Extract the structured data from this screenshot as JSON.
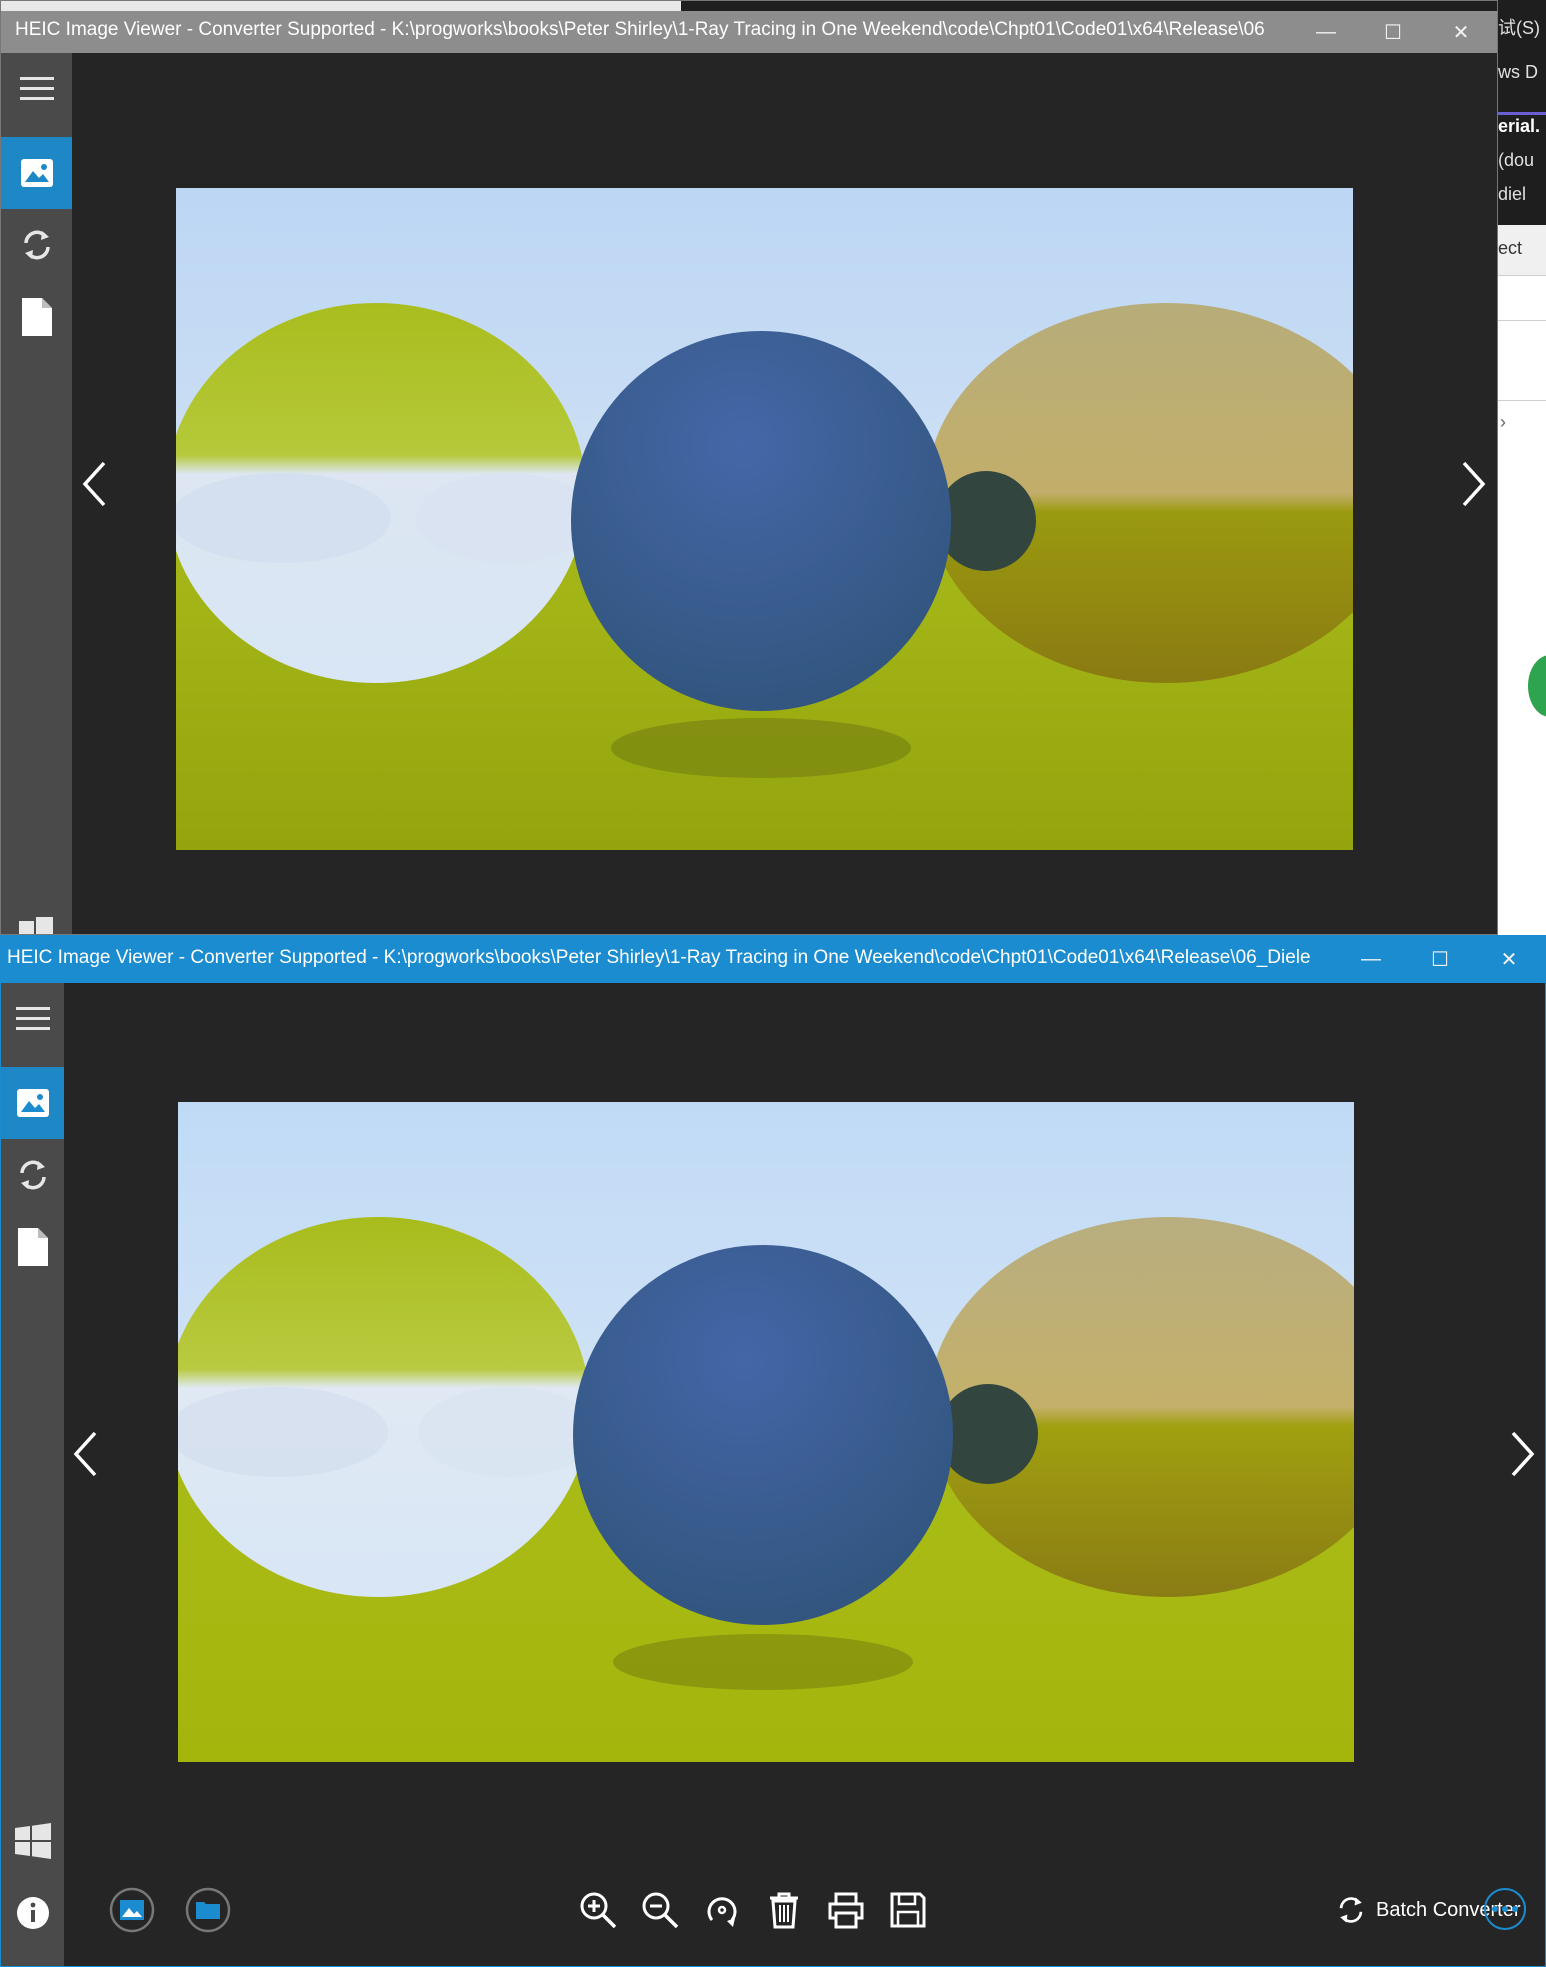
{
  "background_window": {
    "lines": [
      "试(S)",
      "ws D",
      "erial.",
      "(dou",
      "diel",
      "ect"
    ],
    "accent_color": "#6b5fd6"
  },
  "window1": {
    "title": "HEIC Image Viewer - Converter Supported - K:\\progworks\\books\\Peter Shirley\\1-Ray Tracing in One Weekend\\code\\Chpt01\\Code01\\x64\\Release\\06",
    "controls": {
      "minimize": "—",
      "maximize": "☐",
      "close": "✕"
    },
    "sidebar": [
      "menu-icon",
      "image-icon",
      "sync-icon",
      "file-icon"
    ],
    "nav": {
      "prev": "‹",
      "next": "›"
    },
    "active_color": "#1e88c7"
  },
  "window2": {
    "title": "HEIC Image Viewer - Converter Supported - K:\\progworks\\books\\Peter Shirley\\1-Ray Tracing in One Weekend\\code\\Chpt01\\Code01\\x64\\Release\\06_Diele",
    "controls": {
      "minimize": "—",
      "maximize": "☐",
      "close": "✕"
    },
    "sidebar": [
      "menu-icon",
      "image-icon",
      "sync-icon",
      "file-icon",
      "windows-icon",
      "info-icon"
    ],
    "toolbar": {
      "left": [
        "gallery-icon",
        "folder-icon"
      ],
      "center": [
        "zoom-in-icon",
        "zoom-out-icon",
        "rotate-icon",
        "delete-icon",
        "print-icon",
        "save-icon"
      ],
      "batch_label": "Batch Converter"
    },
    "active_color": "#1a8ccf"
  }
}
